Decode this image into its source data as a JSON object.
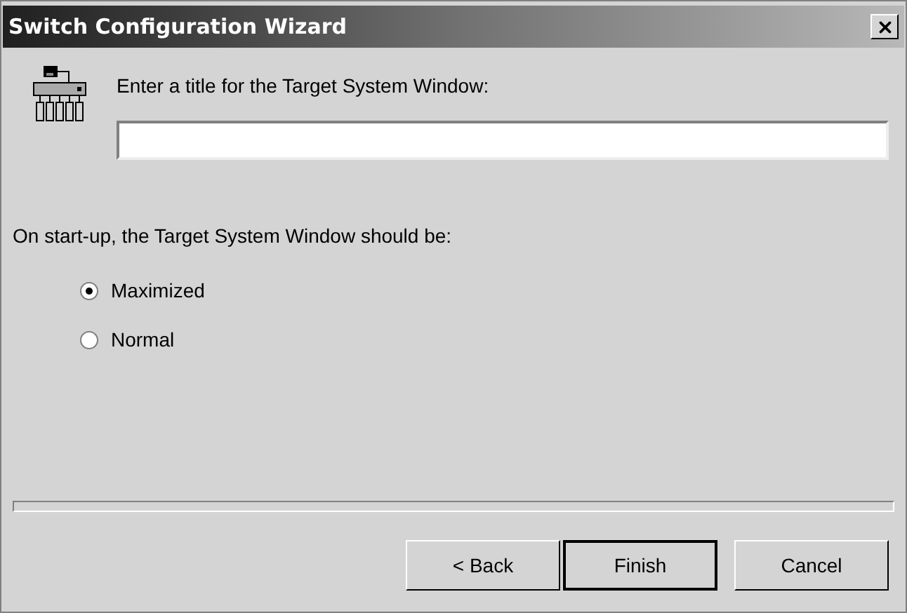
{
  "window": {
    "title": "Switch Configuration Wizard"
  },
  "title_prompt": "Enter a title for the Target System Window:",
  "startup_label": "On start-up, the Target System Window should be:",
  "startup_options": [
    {
      "label": "Maximized",
      "selected": true
    },
    {
      "label": "Normal",
      "selected": false
    }
  ],
  "buttons": [
    {
      "label": "< Back",
      "default": false
    },
    {
      "label": "Finish",
      "default": true
    },
    {
      "label": "Cancel",
      "default": false
    }
  ]
}
